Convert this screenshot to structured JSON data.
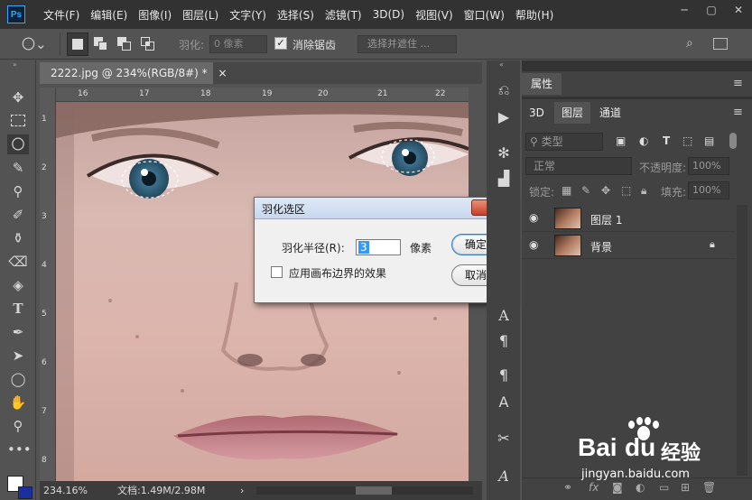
{
  "app": {
    "logo": "Ps"
  },
  "menu": [
    "文件(F)",
    "编辑(E)",
    "图像(I)",
    "图层(L)",
    "文字(Y)",
    "选择(S)",
    "滤镜(T)",
    "3D(D)",
    "视图(V)",
    "窗口(W)",
    "帮助(H)"
  ],
  "window_buttons": {
    "minimize": "─",
    "restore": "▢",
    "close": "✕"
  },
  "options": {
    "feather_label": "羽化:",
    "feather_value": "0 像素",
    "antialias_label": "消除锯齿",
    "antialias_checked": true,
    "select_mask": "选择并遮住 ..."
  },
  "document": {
    "tab_title": "2222.jpg @ 234%(RGB/8#) *",
    "tab_close": "×",
    "ruler_ticks": [
      "16",
      "17",
      "18",
      "19",
      "20",
      "21",
      "22"
    ],
    "ruler_vticks": [
      "1",
      "2",
      "3",
      "4",
      "5",
      "6",
      "7",
      "8"
    ]
  },
  "status": {
    "zoom": "234.16%",
    "doc_info": "文档:1.49M/2.98M",
    "arrow": "›"
  },
  "dialog": {
    "title": "羽化选区",
    "radius_label": "羽化半径(R):",
    "radius_value": "3",
    "unit": "像素",
    "ok": "确定",
    "cancel": "取消",
    "checkbox_label": "应用画布边界的效果",
    "checkbox_checked": false,
    "close": "✕"
  },
  "panels": {
    "properties_title": "属性",
    "tabs": [
      "3D",
      "图层",
      "通道"
    ],
    "active_tab": "图层",
    "filter_kind": "类型",
    "blend_mode": "正常",
    "opacity_label": "不透明度:",
    "opacity_value": "100%",
    "lock_label": "锁定:",
    "fill_label": "填充:",
    "fill_value": "100%",
    "layers": [
      {
        "name": "图层 1",
        "visible": true,
        "locked": false
      },
      {
        "name": "背景",
        "visible": true,
        "locked": true
      }
    ]
  },
  "watermark": {
    "logo": "Bai",
    "brand": "经验",
    "url": "jingyan.baidu.com"
  },
  "colors": {
    "accent": "#31a8ff",
    "chrome_dark": "#323232",
    "panel": "#424242",
    "workspace": "#535353"
  }
}
